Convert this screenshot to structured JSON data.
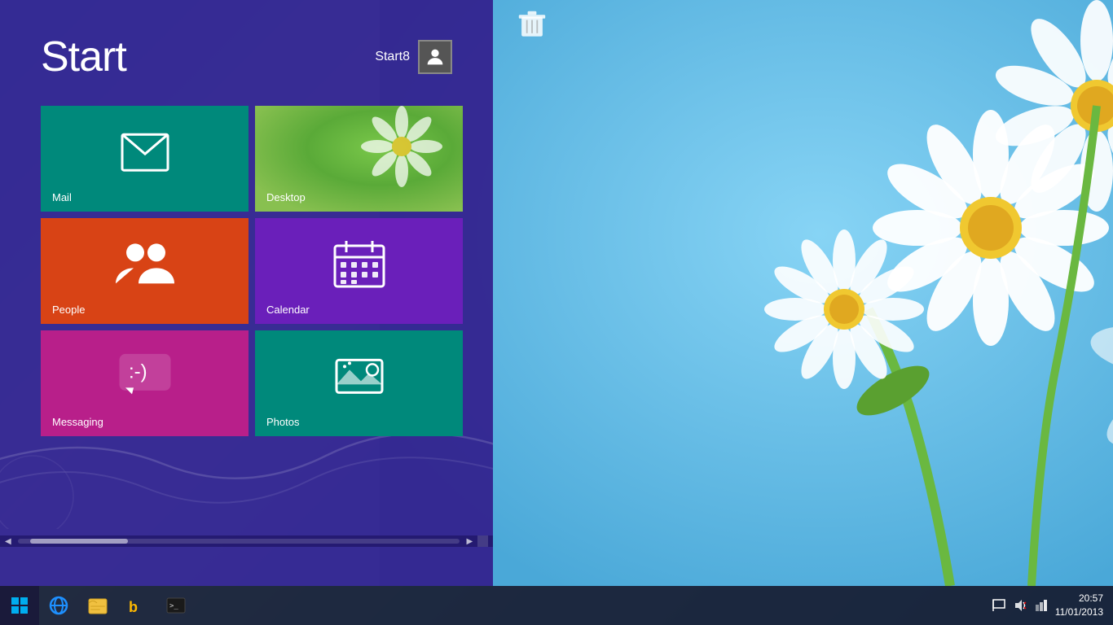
{
  "desktop": {
    "bg_color": "#5ab8e8"
  },
  "start_panel": {
    "title": "Start",
    "bg_color": "#2d1f8a"
  },
  "user": {
    "name": "Start8",
    "avatar_icon": "person-icon"
  },
  "tiles": [
    {
      "id": "mail",
      "label": "Mail",
      "color": "#00897b",
      "icon": "mail-icon"
    },
    {
      "id": "desktop",
      "label": "Desktop",
      "color": "#5a9a3a",
      "icon": "desktop-icon"
    },
    {
      "id": "people",
      "label": "People",
      "color": "#d84315",
      "icon": "people-icon"
    },
    {
      "id": "calendar",
      "label": "Calendar",
      "color": "#6a1fba",
      "icon": "calendar-icon"
    },
    {
      "id": "messaging",
      "label": "Messaging",
      "color": "#b81f8a",
      "icon": "messaging-icon"
    },
    {
      "id": "photos",
      "label": "Photos",
      "color": "#00897b",
      "icon": "photos-icon"
    }
  ],
  "taskbar": {
    "apps": [
      {
        "id": "start",
        "label": "Start",
        "icon": "windows-icon"
      },
      {
        "id": "ie",
        "label": "Internet Explorer",
        "icon": "ie-icon"
      },
      {
        "id": "explorer",
        "label": "File Explorer",
        "icon": "explorer-icon"
      },
      {
        "id": "bing",
        "label": "Bing",
        "icon": "bing-icon"
      },
      {
        "id": "cmd",
        "label": "Command Prompt",
        "icon": "cmd-icon"
      }
    ],
    "clock": {
      "time": "20:57",
      "date": "11/01/2013"
    }
  },
  "recycle_bin": {
    "label": ""
  }
}
